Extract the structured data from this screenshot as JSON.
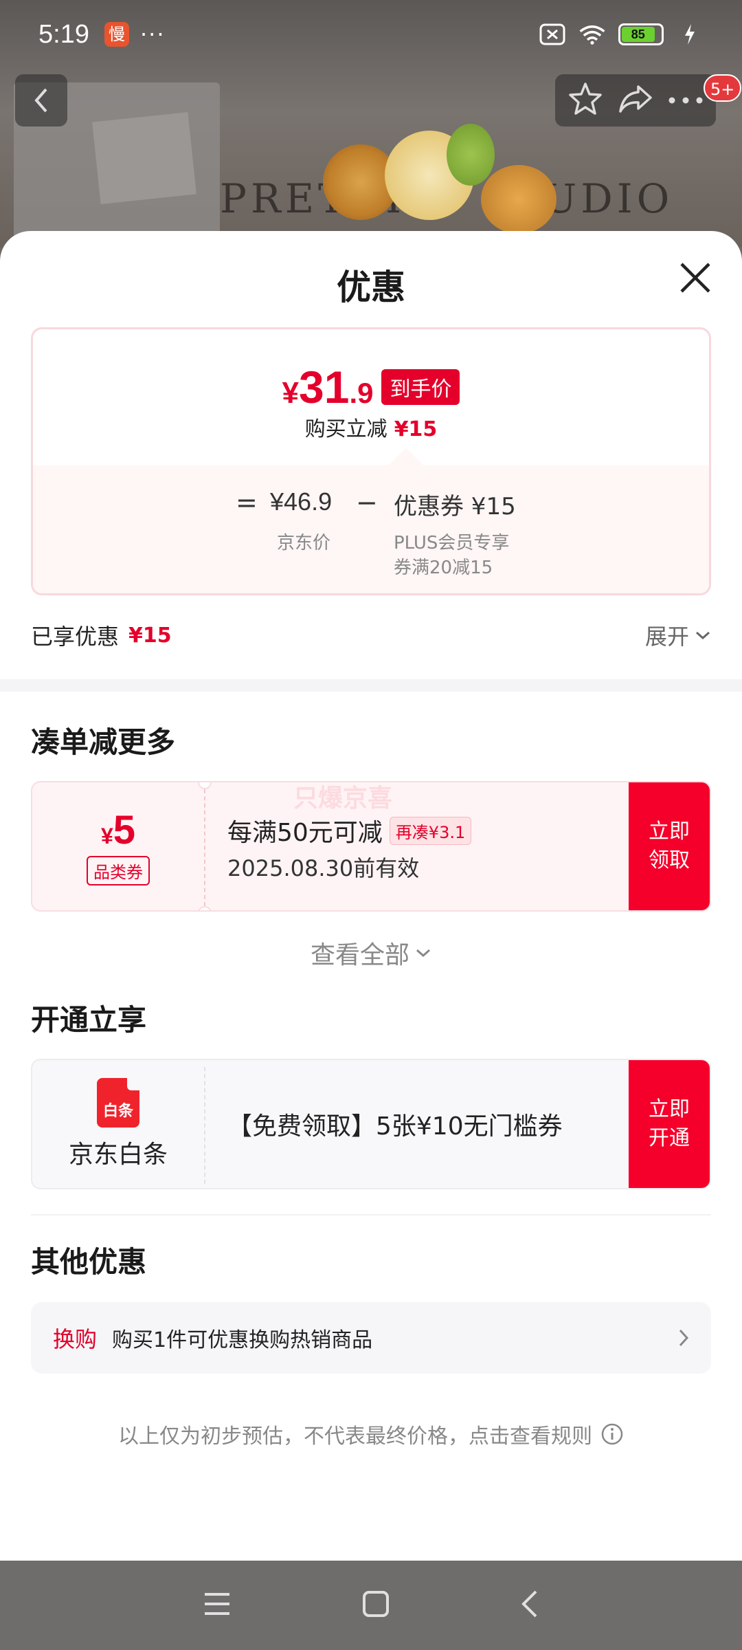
{
  "status_bar": {
    "time": "5:19",
    "app_badge": "慢",
    "more": "···",
    "battery": "85"
  },
  "nav": {
    "badge": "5+"
  },
  "sheet": {
    "title": "优惠"
  },
  "price_card": {
    "currency": "¥",
    "price_int": "31",
    "price_dec": ".9",
    "price_tag": "到手价",
    "sub_label": "购买立减",
    "sub_value": "¥15",
    "equals": "=",
    "jd_price": "¥46.9",
    "minus": "−",
    "coupon_text": "优惠券 ¥15",
    "jd_price_label": "京东价",
    "coupon_line1": "PLUS会员专享",
    "coupon_line2": "券满20减15"
  },
  "enjoyed": {
    "label": "已享优惠",
    "value": "¥15",
    "expand": "展开"
  },
  "section_more": {
    "title": "凑单减更多",
    "coupon": {
      "symbol": "¥",
      "amount": "5",
      "category": "品类券",
      "watermark": "只爆京喜",
      "rule": "每满50元可减",
      "more_tag": "再凑¥3.1",
      "validity": "2025.08.30前有效",
      "button": "立即\n领取"
    },
    "view_all": "查看全部"
  },
  "section_open": {
    "title": "开通立享",
    "card": {
      "logo_text": "白条",
      "name": "京东白条",
      "offer": "【免费领取】5张¥10无门槛券",
      "button": "立即\n开通"
    }
  },
  "section_other": {
    "title": "其他优惠",
    "row": {
      "tag": "换购",
      "text": "购买1件可优惠换购热销商品"
    }
  },
  "disclaimer": "以上仅为初步预估，不代表最终价格，点击查看规则",
  "colors": {
    "accent_red": "#e4002b",
    "button_red": "#f5002a"
  }
}
